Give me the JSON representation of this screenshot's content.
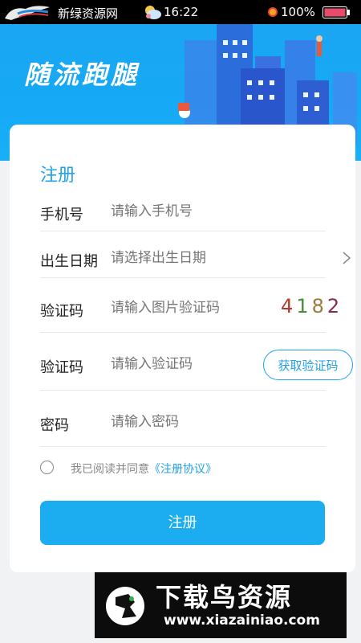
{
  "status_bar": {
    "carrier": "新绿资源网",
    "time": "16:22",
    "battery": "100%"
  },
  "header": {
    "app_title": "随流跑腿"
  },
  "form": {
    "title": "注册",
    "phone": {
      "label": "手机号",
      "placeholder": "请输入手机号"
    },
    "birthday": {
      "label": "出生日期",
      "placeholder": "请选择出生日期"
    },
    "image_code": {
      "label": "验证码",
      "placeholder": "请输入图片验证码",
      "captcha": [
        "4",
        "1",
        "8",
        "2"
      ]
    },
    "sms_code": {
      "label": "验证码",
      "placeholder": "请输入验证码",
      "button": "获取验证码"
    },
    "password": {
      "label": "密码",
      "placeholder": "请输入密码"
    },
    "agreement": {
      "text": "我已阅读并同意",
      "link": "《注册协议》"
    },
    "submit": "注册"
  },
  "watermark": {
    "title": "下载鸟资源",
    "url": "www.xiazainiao.com"
  },
  "colors": {
    "accent": "#1badef",
    "banner": "#16a9f5"
  }
}
